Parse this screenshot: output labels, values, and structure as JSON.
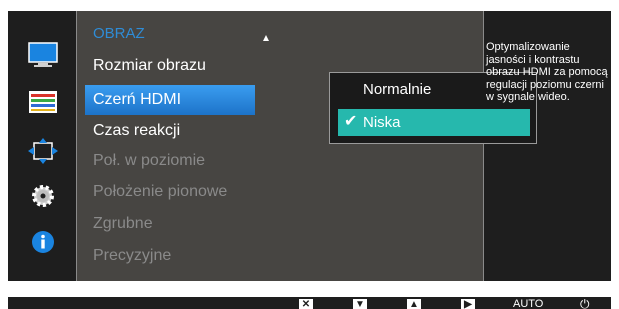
{
  "sidebar": {
    "icons": [
      "picture-icon",
      "color-icon",
      "size-position-icon",
      "setup-icon",
      "information-icon"
    ]
  },
  "menu": {
    "title": "OBRAZ",
    "items": [
      {
        "label": "Rozmiar obrazu",
        "state": "normal"
      },
      {
        "label": "Czerń HDMI",
        "state": "selected"
      },
      {
        "label": "Czas reakcji",
        "state": "normal"
      },
      {
        "label": "Poł. w poziomie",
        "state": "disabled"
      },
      {
        "label": "Położenie pionowe",
        "state": "disabled"
      },
      {
        "label": "Zgrubne",
        "state": "disabled"
      },
      {
        "label": "Precyzyjne",
        "state": "disabled"
      }
    ]
  },
  "submenu": {
    "options": [
      {
        "label": "Normalnie",
        "selected": false
      },
      {
        "label": "Niska",
        "selected": true
      }
    ],
    "check_glyph": "✔"
  },
  "help": {
    "text": "Optymalizowanie jasności i kontrastu obrazu HDMI za pomocą regulacji poziomu czerni w sygnale wideo."
  },
  "bottom_bar": {
    "auto_label": "AUTO",
    "power_glyph": "⏻"
  },
  "colors": {
    "accent": "#2f8cd6",
    "submenu_selected": "#26b8ad",
    "menu_bg": "#474542",
    "osd_bg": "#1e1e1e"
  }
}
